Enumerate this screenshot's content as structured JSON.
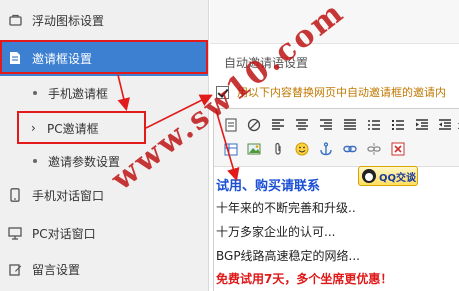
{
  "sidebar": {
    "items": [
      {
        "label": "浮动图标设置",
        "icon": "float-icon-settings-icon"
      },
      {
        "label": "邀请框设置",
        "icon": "document-icon",
        "active": true
      },
      {
        "label": "手机对话窗口",
        "icon": "mobile-phone-icon"
      },
      {
        "label": "PC对话窗口",
        "icon": "monitor-icon"
      },
      {
        "label": "留言设置",
        "icon": "message-edit-icon"
      }
    ],
    "subitems": [
      {
        "label": "手机邀请框"
      },
      {
        "label": "PC邀请框",
        "selected": true
      },
      {
        "label": "邀请参数设置"
      }
    ]
  },
  "settings": {
    "legend": "自动邀请语设置",
    "auto_invite_checkbox_label": "用以下内容替换网页中自动邀请框的邀请内",
    "auto_invite_checked": true
  },
  "editor": {
    "lines": [
      "试用、购买请联系",
      "十年来的不断完善和升级..",
      "十万多家企业的认可...",
      "BGP线路高速稳定的网络...",
      "免费试用7天，多个坐席更优惠！"
    ],
    "qq_button_label": "QQ交谈"
  },
  "watermark": "www.sw10.com",
  "colors": {
    "accent": "#3d7fd1",
    "annotation": "#e21a1a",
    "editor_blue": "#1a4fd6",
    "editor_red": "#e01818"
  }
}
